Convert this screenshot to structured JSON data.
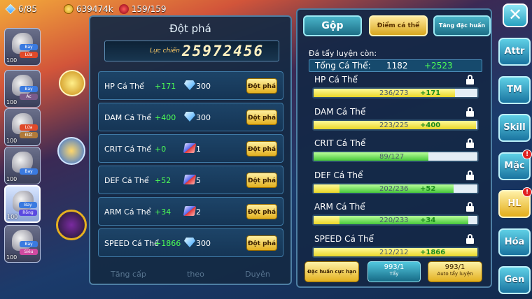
{
  "resources": {
    "gems": "6/85",
    "gold": "639474k",
    "fruit": "159/159"
  },
  "team": [
    {
      "level": "100",
      "tags": [
        "Bay",
        "Lửa"
      ],
      "tag_colors": [
        "#3a7ae0",
        "#e04a2a"
      ]
    },
    {
      "level": "100",
      "tags": [
        "Bay",
        "Ác"
      ],
      "tag_colors": [
        "#3a7ae0",
        "#7a5a8a"
      ]
    },
    {
      "level": "100",
      "tags": [
        "Lửa",
        "Đất"
      ],
      "tag_colors": [
        "#e04a2a",
        "#b07a3a"
      ]
    },
    {
      "level": "100",
      "tags": [
        "Bay"
      ],
      "tag_colors": [
        "#3a7ae0"
      ]
    },
    {
      "level": "100",
      "tags": [
        "Bay",
        "Rồng"
      ],
      "tag_colors": [
        "#3a7ae0",
        "#5a4ae0"
      ]
    },
    {
      "level": "100",
      "tags": [
        "Bay",
        "Siêu"
      ],
      "tag_colors": [
        "#3a7ae0",
        "#d04aa0"
      ]
    }
  ],
  "breakthrough": {
    "title": "Đột phá",
    "power_label": "Lực chiến",
    "power_value": "25972456",
    "button_label": "Đột phá",
    "rows": [
      {
        "name": "HP Cá Thể",
        "bonus": "+171",
        "cost_icon": "gem-icon",
        "cost": "300"
      },
      {
        "name": "DAM Cá Thể",
        "bonus": "+400",
        "cost_icon": "gem-icon",
        "cost": "300"
      },
      {
        "name": "CRIT Cá Thể",
        "bonus": "+0",
        "cost_icon": "book-icon",
        "cost": "1"
      },
      {
        "name": "DEF Cá Thể",
        "bonus": "+52",
        "cost_icon": "book-icon",
        "cost": "5"
      },
      {
        "name": "ARM Cá Thể",
        "bonus": "+34",
        "cost_icon": "book-icon",
        "cost": "2"
      },
      {
        "name": "SPEED Cá Thể",
        "bonus": "+1866",
        "cost_icon": "gem-icon",
        "cost": "300"
      }
    ],
    "bottom_labels": [
      "Tăng cấp",
      "theo",
      "Duyên"
    ]
  },
  "training": {
    "tabs": [
      "Gộp",
      "Điểm cá thể",
      "Tăng đặc huấn"
    ],
    "remaining_label": "Đá tẩy luyện còn:",
    "total_label": "Tổng Cá Thể:",
    "total_value": "1182",
    "total_bonus": "+2523",
    "stats": [
      {
        "name": "HP Cá Thể",
        "value": "236/273",
        "bonus": "+171",
        "current": 236,
        "max": 273,
        "color": "yellow"
      },
      {
        "name": "DAM Cá Thể",
        "value": "223/225",
        "bonus": "+400",
        "current": 223,
        "max": 225,
        "color": "yellow"
      },
      {
        "name": "CRIT Cá Thể",
        "value": "89/127",
        "bonus": "",
        "current": 89,
        "max": 127,
        "color": "green"
      },
      {
        "name": "DEF Cá Thể",
        "value": "202/236",
        "bonus": "+52",
        "current": 202,
        "max": 236,
        "color": "mixed"
      },
      {
        "name": "ARM Cá Thể",
        "value": "220/233",
        "bonus": "+34",
        "current": 220,
        "max": 233,
        "color": "mixed"
      },
      {
        "name": "SPEED Cá Thể",
        "value": "212/212",
        "bonus": "+1866",
        "current": 212,
        "max": 212,
        "color": "yellow"
      }
    ],
    "buttons": {
      "special": "Đặc huấn cực hạn",
      "wash_count": "993/1",
      "wash_label": "Tẩy",
      "auto_count": "993/1",
      "auto_label": "Auto tẩy luyện"
    }
  },
  "side_menu": [
    {
      "label": "Attr",
      "highlight": false,
      "badge": false
    },
    {
      "label": "TM",
      "highlight": false,
      "badge": false
    },
    {
      "label": "Skill",
      "highlight": false,
      "badge": false
    },
    {
      "label": "Mặc",
      "highlight": false,
      "badge": true
    },
    {
      "label": "HL",
      "highlight": true,
      "badge": true
    },
    {
      "label": "Hóa",
      "highlight": false,
      "badge": false
    },
    {
      "label": "Gen",
      "highlight": false,
      "badge": false
    }
  ],
  "close_symbol": "✕",
  "badge_symbol": "!"
}
